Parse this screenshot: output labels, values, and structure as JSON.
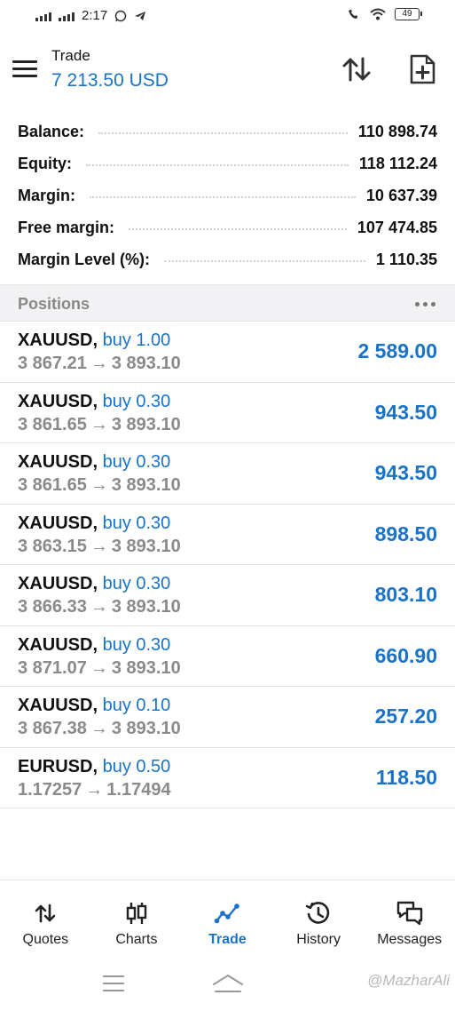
{
  "status_bar": {
    "time": "2:17",
    "battery": "49"
  },
  "header": {
    "title": "Trade",
    "subtitle": "7 213.50 USD"
  },
  "account": [
    {
      "label": "Balance:",
      "value": "110 898.74"
    },
    {
      "label": "Equity:",
      "value": "118 112.24"
    },
    {
      "label": "Margin:",
      "value": "10 637.39"
    },
    {
      "label": "Free margin:",
      "value": "107 474.85"
    },
    {
      "label": "Margin Level (%):",
      "value": "1 110.35"
    }
  ],
  "positions": {
    "title": "Positions",
    "items": [
      {
        "symbol": "XAUUSD,",
        "side": "buy 1.00",
        "open": "3 867.21",
        "arrow": "→",
        "current": "3 893.10",
        "profit": "2 589.00"
      },
      {
        "symbol": "XAUUSD,",
        "side": "buy 0.30",
        "open": "3 861.65",
        "arrow": "→",
        "current": "3 893.10",
        "profit": "943.50"
      },
      {
        "symbol": "XAUUSD,",
        "side": "buy 0.30",
        "open": "3 861.65",
        "arrow": "→",
        "current": "3 893.10",
        "profit": "943.50"
      },
      {
        "symbol": "XAUUSD,",
        "side": "buy 0.30",
        "open": "3 863.15",
        "arrow": "→",
        "current": "3 893.10",
        "profit": "898.50"
      },
      {
        "symbol": "XAUUSD,",
        "side": "buy 0.30",
        "open": "3 866.33",
        "arrow": "→",
        "current": "3 893.10",
        "profit": "803.10"
      },
      {
        "symbol": "XAUUSD,",
        "side": "buy 0.30",
        "open": "3 871.07",
        "arrow": "→",
        "current": "3 893.10",
        "profit": "660.90"
      },
      {
        "symbol": "XAUUSD,",
        "side": "buy 0.10",
        "open": "3 867.38",
        "arrow": "→",
        "current": "3 893.10",
        "profit": "257.20"
      },
      {
        "symbol": "EURUSD,",
        "side": "buy 0.50",
        "open": "1.17257",
        "arrow": "→",
        "current": "1.17494",
        "profit": "118.50"
      }
    ]
  },
  "bottom_nav": [
    {
      "label": "Quotes",
      "icon": "quotes-icon"
    },
    {
      "label": "Charts",
      "icon": "charts-icon"
    },
    {
      "label": "Trade",
      "icon": "trade-icon",
      "active": true
    },
    {
      "label": "History",
      "icon": "history-icon"
    },
    {
      "label": "Messages",
      "icon": "messages-icon"
    }
  ],
  "watermark": "@MazharAli",
  "colors": {
    "accent": "#1a73c8",
    "muted": "#8a8a8a",
    "section_bg": "#f2f2f4"
  }
}
